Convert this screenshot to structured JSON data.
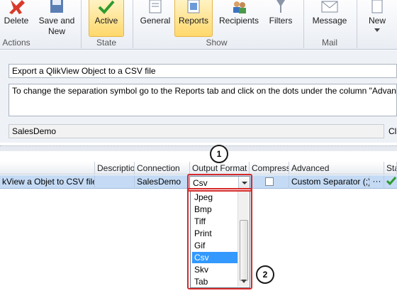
{
  "ribbon": {
    "buttons": {
      "delete": "Delete",
      "save_new": "Save and New",
      "active": "Active",
      "general": "General",
      "reports": "Reports",
      "recipients": "Recipients",
      "filters": "Filters",
      "message": "Message",
      "new": "New"
    },
    "groups": {
      "actions": "Actions",
      "state": "State",
      "show": "Show",
      "mail": "Mail"
    },
    "colors": {
      "active_bg": "#ffd86b",
      "accent_red": "#d62a2a"
    }
  },
  "form": {
    "subject": "Export a QlikView Object to a CSV file",
    "body": "To change the separation symbol go to the Reports tab and click on the dots under the column \"Advanced\"",
    "document": "SalesDemo",
    "right_label": "Cl"
  },
  "grid": {
    "headers": {
      "descriptio": "Descriptio",
      "connection": "Connection",
      "output_format": "Output Format",
      "compress": "Compress",
      "advanced": "Advanced",
      "sta": "Sta"
    },
    "row": {
      "name": "kView a Objet to CSV files",
      "connection": "SalesDemo",
      "output_format": "Csv",
      "advanced": "Custom Separator (;)",
      "advanced_more": "···"
    }
  },
  "dropdown": {
    "options": [
      "Jpeg",
      "Bmp",
      "Tiff",
      "Print",
      "Gif",
      "Csv",
      "Skv",
      "Tab"
    ],
    "selected": "Csv"
  },
  "callouts": {
    "one": "1",
    "two": "2"
  }
}
